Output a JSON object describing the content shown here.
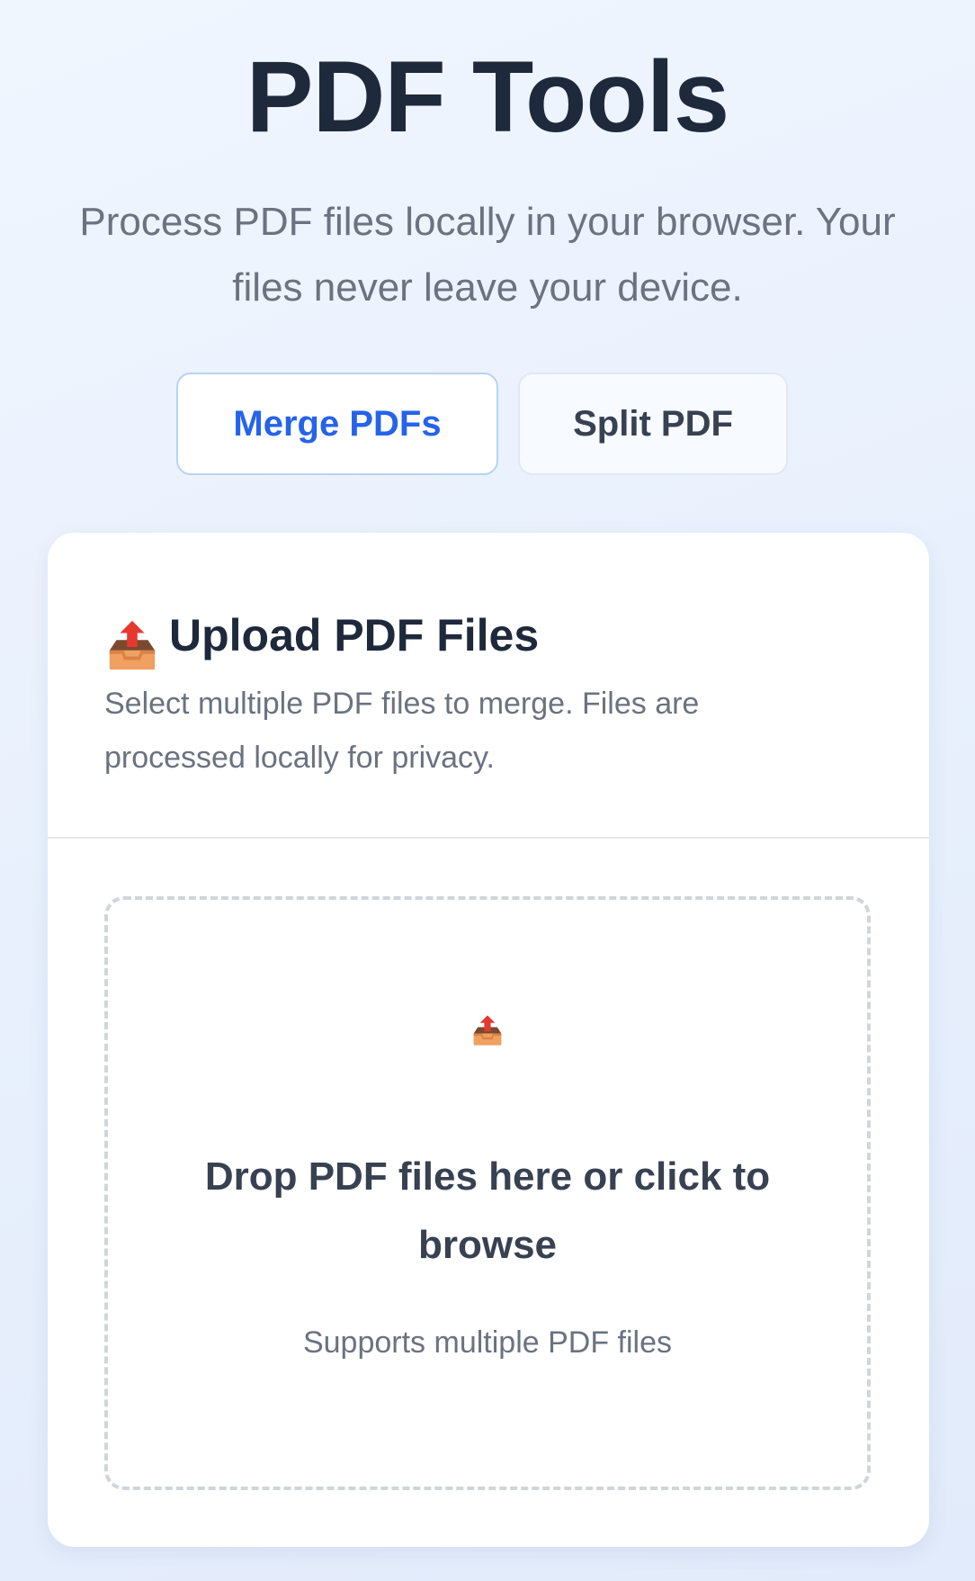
{
  "page": {
    "title": "PDF Tools",
    "subtitle": "Process PDF files locally in your browser. Your files never leave your device."
  },
  "tabs": [
    {
      "label": "Merge PDFs",
      "active": true
    },
    {
      "label": "Split PDF",
      "active": false
    }
  ],
  "upload": {
    "icon": "outbox-tray-icon",
    "title": "Upload PDF Files",
    "description": "Select multiple PDF files to merge. Files are processed locally for privacy.",
    "dropzone": {
      "icon": "outbox-tray-icon",
      "title": "Drop PDF files here or click to browse",
      "subtitle": "Supports multiple PDF files"
    }
  },
  "colors": {
    "accent": "#2563eb",
    "title": "#1e293b",
    "muted": "#6b7280",
    "icon_arrow": "#e5392f",
    "icon_tray": "#f0a060"
  }
}
